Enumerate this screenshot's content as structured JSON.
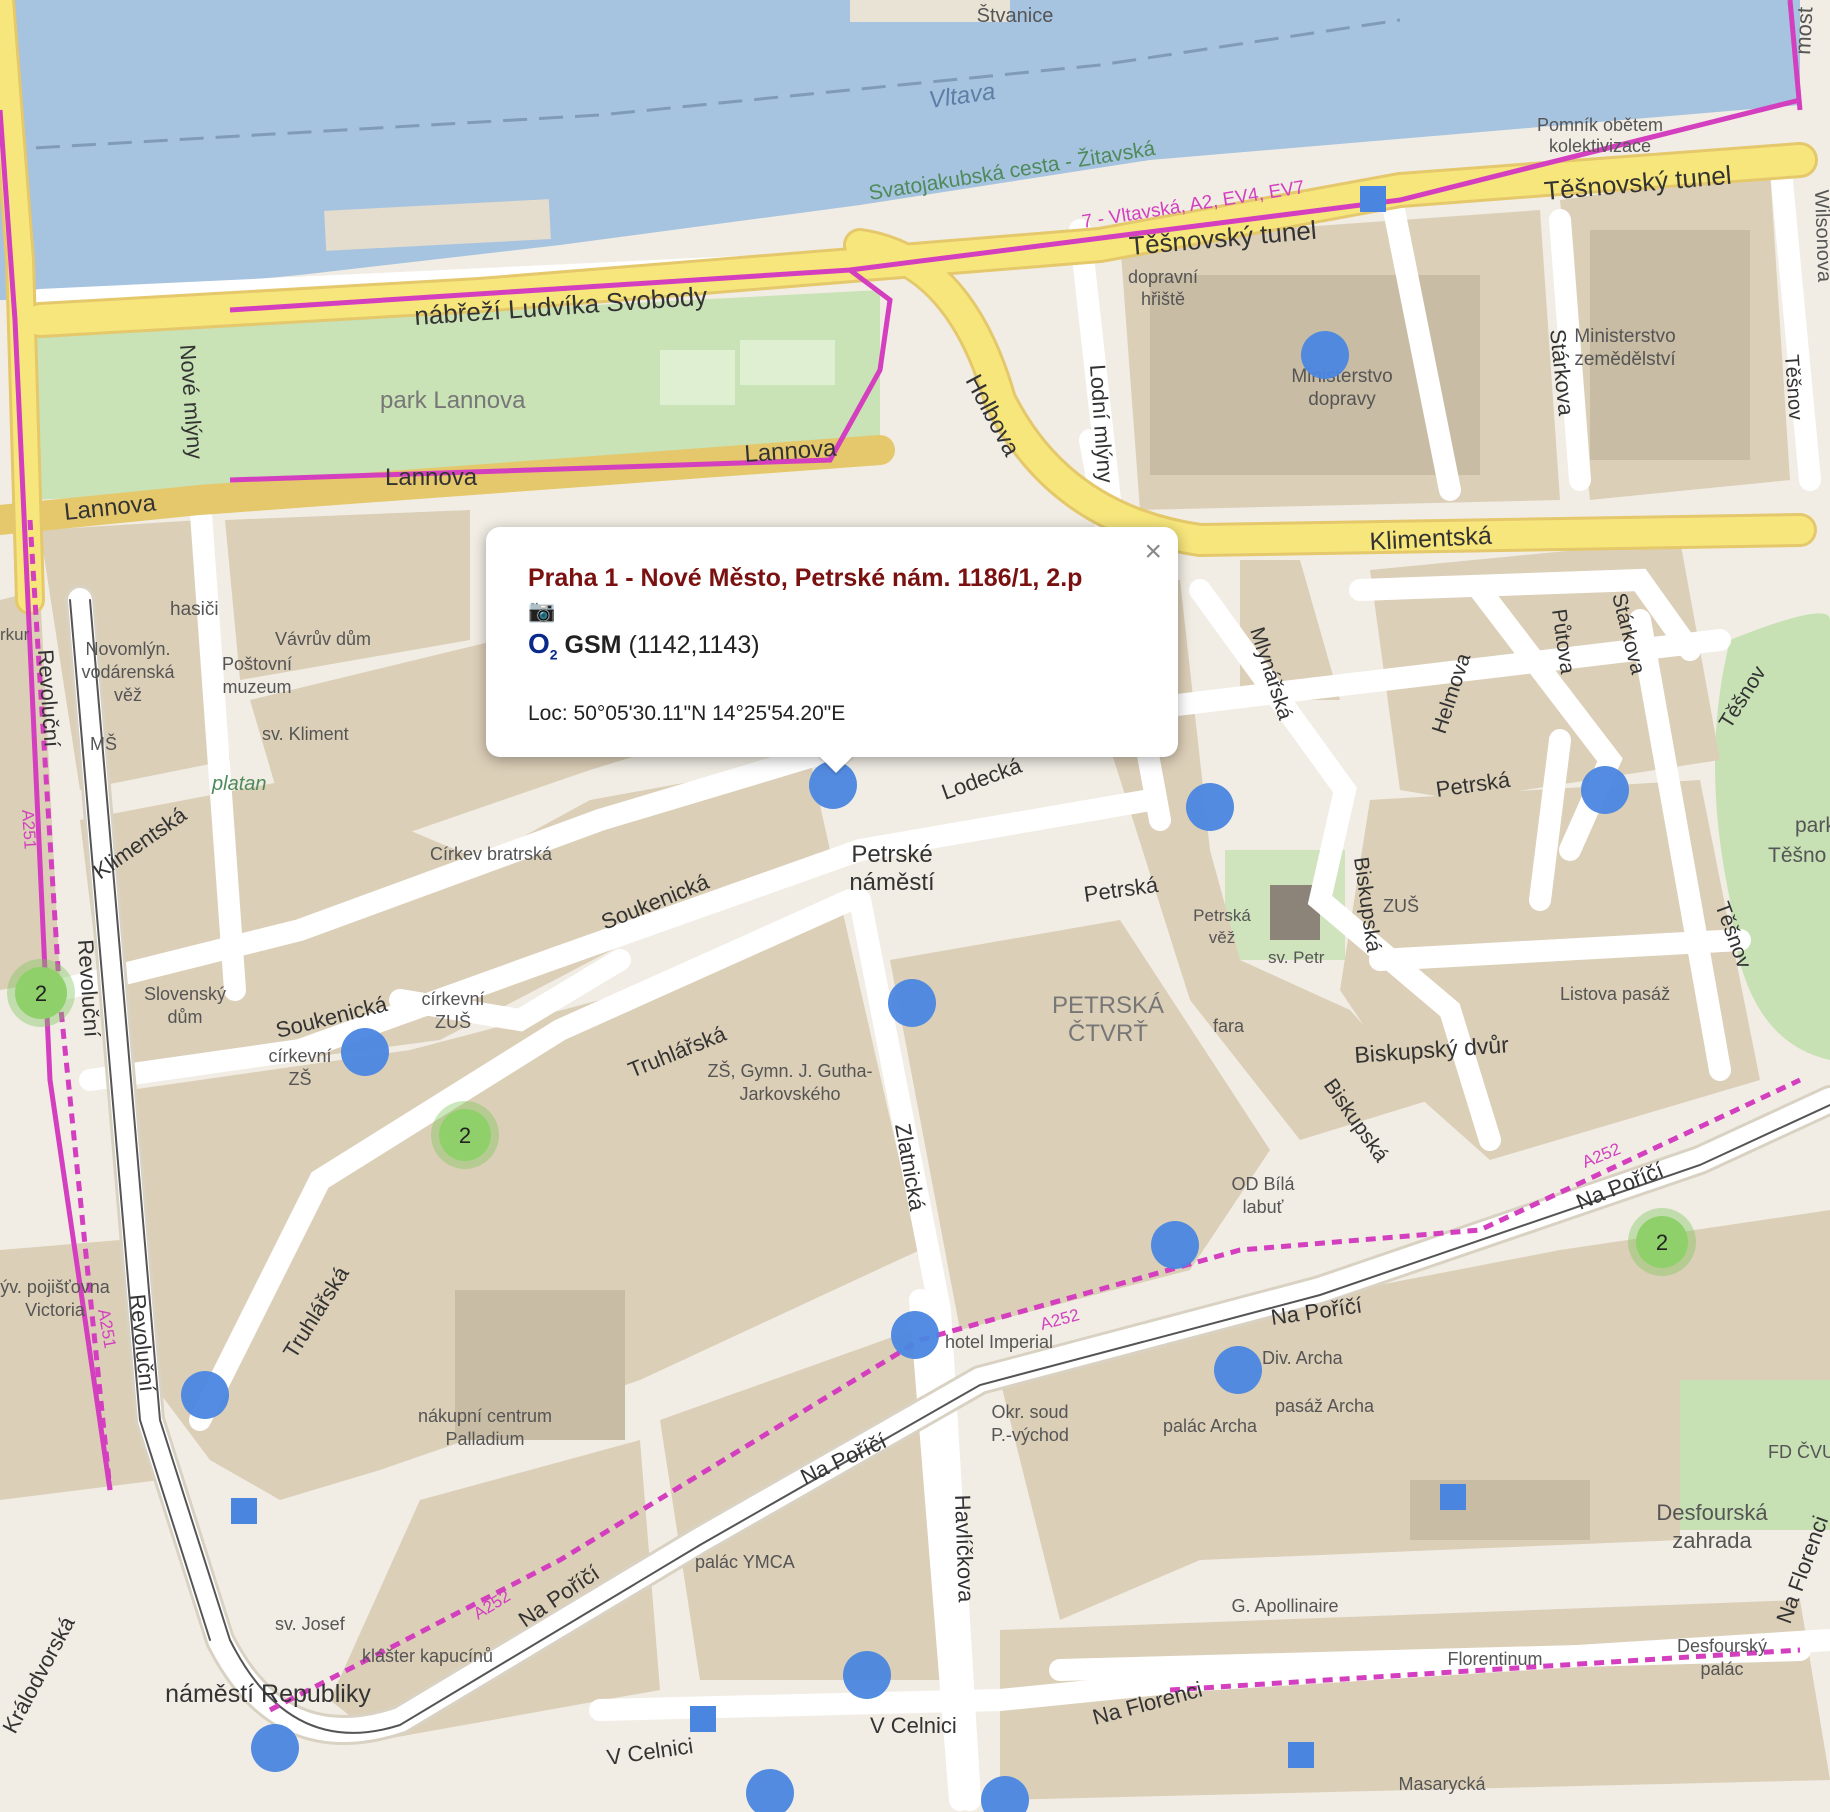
{
  "popup": {
    "title": "Praha 1 - Nové Město, Petrské nám. 1186/1, 2.p",
    "close_glyph": "×",
    "camera_icon": "📷",
    "operator_logo": "O",
    "operator_logo_sub": "2",
    "network": "GSM",
    "cells": "(1142,1143)",
    "location": "Loc: 50°05'30.11\"N 14°25'54.20\"E"
  },
  "clusters": [
    {
      "count": "2"
    },
    {
      "count": "2"
    },
    {
      "count": "2"
    }
  ],
  "map_labels": {
    "stvanice": "Štvanice",
    "vltava": "Vltava",
    "most": "most",
    "svatojakubska": "Svatojakubská cesta - Žitavská",
    "cycle_route": "7 - Vltavská, A2, EV4, EV7",
    "pomnik": "Pomník obětem",
    "kolektivizace": "kolektivizace",
    "tesnovsky1": "Těšnovský tunel",
    "tesnovsky2": "Těšnovský tunel",
    "wilsonova": "Wilsonova",
    "nabrezi": "nábřeží Ludvíka Svobody",
    "park_lannova": "park Lannova",
    "nove_mlyny": "Nové mlýny",
    "lannova1": "Lannova",
    "lannova2": "Lannova",
    "lannova3": "Lannova",
    "holbova": "Holbova",
    "lodni_mlyny": "Lodní mlýny",
    "dopravni": "dopravní",
    "hriste": "hřiště",
    "ministerstvo_d1": "Ministerstvo",
    "ministerstvo_d2": "dopravy",
    "starkova1": "Stárkova",
    "starkova2": "Stárkova",
    "ministerstvo_z1": "Ministerstvo",
    "ministerstvo_z2": "zemědělství",
    "tesnov1": "Těšnov",
    "tesnov2": "Těšnov",
    "tesnov3": "Těšnov",
    "klimentska1": "Klimentská",
    "klimentska2": "Klimentská",
    "mlynarska": "Mlynářská",
    "helmova": "Helmova",
    "putova": "Půtova",
    "park_tesnov1": "park",
    "park_tesnov2": "Těšno",
    "hasici": "hasiči",
    "vavruv": "Vávrův dům",
    "novomlyn1": "Novomlýn.",
    "novomlyn2": "vodárenská",
    "novomlyn3": "věž",
    "postovni1": "Poštovní",
    "postovni2": "muzeum",
    "ms": "MŠ",
    "sv_kliment": "sv. Kliment",
    "platan": "platan",
    "revolucni1": "Revoluční",
    "revolucni2": "Revoluční",
    "revolucni3": "Revoluční",
    "a251_1": "A251",
    "a251_2": "A251",
    "lodecka": "Lodecká",
    "petrske1": "Petrské",
    "petrske2": "náměstí",
    "petrska1": "Petrská",
    "petrska2": "Petrská",
    "cirkev": "Církev bratrská",
    "soukenicka1": "Soukenická",
    "soukenicka2": "Soukenická",
    "slovensky1": "Slovenský",
    "slovensky2": "dům",
    "cirkevni_zus1": "církevní",
    "cirkevni_zus2": "ZUŠ",
    "cirkevni_zs1": "církevní",
    "cirkevni_zs2": "ZŠ",
    "truhlarska1": "Truhlářská",
    "truhlarska2": "Truhlářská",
    "zs_gymn1": "ZŠ, Gymn. J. Gutha-",
    "zs_gymn2": "Jarkovského",
    "zlatnicka": "Zlatnická",
    "petrska_ctvrt1": "PETRSKÁ",
    "petrska_ctvrt2": "ČTVRŤ",
    "fara": "fara",
    "petrska_vez1": "Petrská",
    "petrska_vez2": "věž",
    "sv_petr": "sv. Petr",
    "biskupska1": "Biskupská",
    "biskupska2": "Biskupská",
    "zus": "ZUŠ",
    "listova": "Listova pasáž",
    "biskupsky_dvur": "Biskupský dvůr",
    "od_bila1": "OD Bílá",
    "od_bila2": "labuť",
    "a252_1": "A252",
    "a252_2": "A252",
    "a252_3": "A252",
    "na_porici1": "Na Poříčí",
    "na_porici2": "Na Poříčí",
    "na_porici3": "Na Poříčí",
    "na_porici4": "Na Poříčí",
    "hotel_imperial": "hotel Imperial",
    "div_archa": "Div. Archa",
    "pasaz_archa": "pasáž Archa",
    "palac_archa": "palác Archa",
    "okr_soud1": "Okr. soud",
    "okr_soud2": "P.-východ",
    "pojistovna1": "ýv. pojišťovna",
    "pojistovna2": "Victoria",
    "palladium1": "nákupní centrum",
    "palladium2": "Palladium",
    "palac_ymca": "palác YMCA",
    "havlickova": "Havlíčkova",
    "sv_josef": "sv. Josef",
    "klaster": "klášter kapucínů",
    "namesti_republiky": "náměstí Republiky",
    "kralodvorska": "Králodvorská",
    "g_apollinaire": "G. Apollinaire",
    "florentinum": "Florentinum",
    "na_florenci1": "Na Florenci",
    "na_florenci2": "Na Florenci",
    "desfourska1": "Desfourská",
    "desfourska2": "zahrada",
    "desfoursky1": "Desfourský",
    "desfoursky2": "palác",
    "fd_cvut": "FD ČVUT",
    "v_celnici1": "V Celnici",
    "v_celnici2": "V Celnici",
    "masarycka": "Masarycká",
    "rku": "rkur"
  },
  "colors": {
    "water": "#a6c3df",
    "block": "#dccfb8",
    "park": "#c7e1b5",
    "road": "#ffffff",
    "primary_road": "#f7e67c",
    "cycle_route": "#d33fbf",
    "marker": "#4a86e0",
    "cluster": "#7dc65a",
    "popup_title": "#7a1010"
  }
}
